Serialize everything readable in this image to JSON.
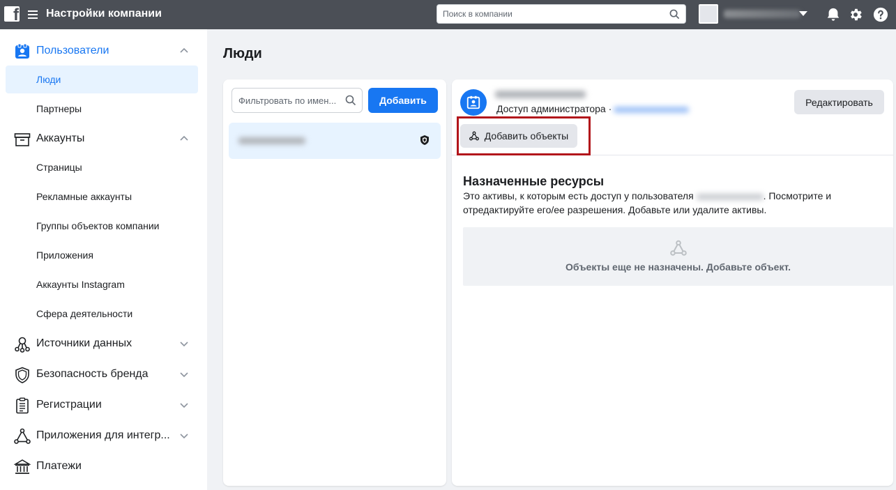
{
  "header": {
    "title": "Настройки компании",
    "search_placeholder": "Поиск в компании"
  },
  "sidebar": {
    "sections": [
      {
        "label": "Пользователи",
        "icon": "users-icon",
        "expanded": true,
        "items": [
          {
            "label": "Люди",
            "active": true
          },
          {
            "label": "Партнеры"
          }
        ]
      },
      {
        "label": "Аккаунты",
        "icon": "accounts-icon",
        "expanded": true,
        "items": [
          {
            "label": "Страницы"
          },
          {
            "label": "Рекламные аккаунты"
          },
          {
            "label": "Группы объектов компании"
          },
          {
            "label": "Приложения"
          },
          {
            "label": "Аккаунты Instagram"
          },
          {
            "label": "Сфера деятельности"
          }
        ]
      },
      {
        "label": "Источники данных",
        "icon": "data-sources-icon"
      },
      {
        "label": "Безопасность бренда",
        "icon": "shield-icon"
      },
      {
        "label": "Регистрации",
        "icon": "clipboard-icon"
      },
      {
        "label": "Приложения для интегр...",
        "icon": "integrations-icon"
      },
      {
        "label": "Платежи",
        "icon": "bank-icon"
      }
    ]
  },
  "main": {
    "title": "Люди",
    "filter_placeholder": "Фильтровать по имен...",
    "add_button": "Добавить",
    "detail": {
      "access_label": "Доступ администратора ·",
      "edit_button": "Редактировать",
      "add_assets_button": "Добавить объекты",
      "section_title": "Назначенные ресурсы",
      "desc_part1": "Это активы, к которым есть доступ у пользователя",
      "desc_part2": ". Посмотрите и отредактируйте его/ее разрешения. Добавьте или удалите активы.",
      "empty_text": "Объекты еще не назначены. Добавьте объект."
    }
  },
  "colors": {
    "accent": "#1877f2",
    "topbar": "#4b4f56",
    "highlight": "#b2151b"
  }
}
